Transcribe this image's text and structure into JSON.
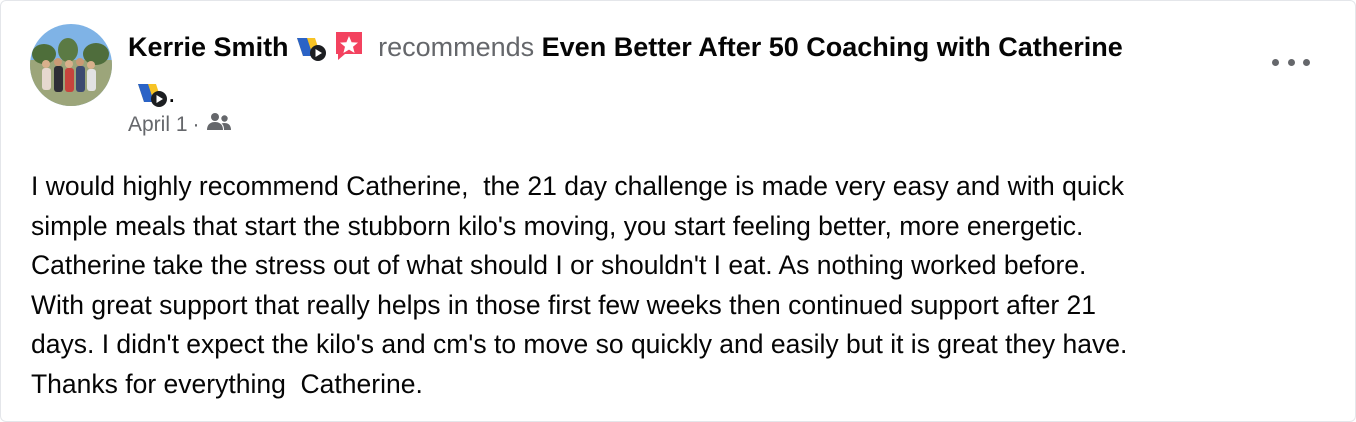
{
  "post": {
    "author": "Kerrie Smith",
    "action": "recommends",
    "page": "Even Better After 50 Coaching with Catherine",
    "period": ".",
    "date": "April 1",
    "separator": "·",
    "audience_icon": "friends-icon",
    "author_badges": [
      "page-video-badge-icon",
      "recommendation-star-icon"
    ],
    "page_badge": "page-video-badge-icon",
    "more_icon": "more-options-icon",
    "body_lines": [
      "I would highly recommend Catherine,  the 21 day challenge is made very easy and with quick",
      "simple meals that start the stubborn kilo's moving, you start feeling better, more energetic.",
      "Catherine take the stress out of what should I or shouldn't I eat. As nothing worked before.",
      "With great support that really helps in those first few weeks then continued support after 21",
      "days. I didn't expect the kilo's and cm's to move so quickly and easily but it is great they have.",
      "Thanks for everything  Catherine."
    ]
  },
  "colors": {
    "text": "#050505",
    "secondary": "#65676b",
    "badge_yellow": "#f7c325",
    "badge_blue": "#2b63c6",
    "recommend_red": "#f3425f"
  }
}
